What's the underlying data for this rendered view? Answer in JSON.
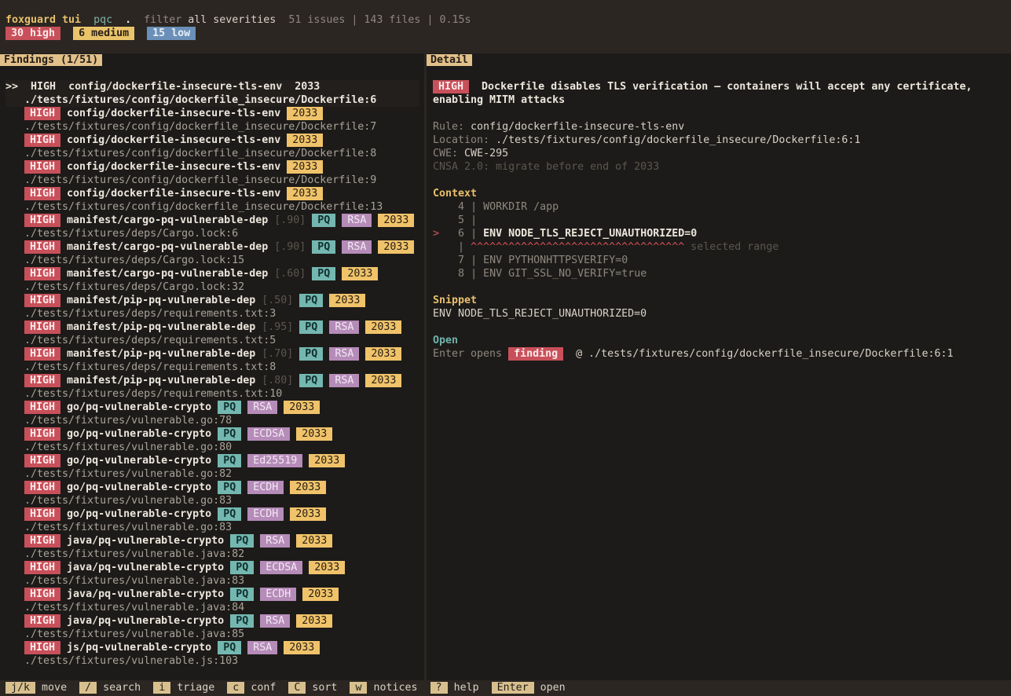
{
  "topbar": {
    "app": "foxguard tui",
    "mode": "pqc",
    "dir": ".",
    "filter_label": "filter",
    "filter_value": "all severities",
    "stats": "51 issues | 143 files | 0.15s",
    "counts": {
      "high": "30 high",
      "medium": "6 medium",
      "low": "15 low"
    }
  },
  "findings": {
    "title": "Findings (1/51)",
    "selected": {
      "marker": ">>",
      "severity": "HIGH",
      "rule": "config/dockerfile-insecure-tls-env",
      "deadline": "2033",
      "location": "./tests/fixtures/config/dockerfile_insecure/Dockerfile:6"
    },
    "items": [
      {
        "severity": "HIGH",
        "rule": "config/dockerfile-insecure-tls-env",
        "conf": "",
        "tags": [],
        "deadline": "2033",
        "location": "./tests/fixtures/config/dockerfile_insecure/Dockerfile:7"
      },
      {
        "severity": "HIGH",
        "rule": "config/dockerfile-insecure-tls-env",
        "conf": "",
        "tags": [],
        "deadline": "2033",
        "location": "./tests/fixtures/config/dockerfile_insecure/Dockerfile:8"
      },
      {
        "severity": "HIGH",
        "rule": "config/dockerfile-insecure-tls-env",
        "conf": "",
        "tags": [],
        "deadline": "2033",
        "location": "./tests/fixtures/config/dockerfile_insecure/Dockerfile:9"
      },
      {
        "severity": "HIGH",
        "rule": "config/dockerfile-insecure-tls-env",
        "conf": "",
        "tags": [],
        "deadline": "2033",
        "location": "./tests/fixtures/config/dockerfile_insecure/Dockerfile:13"
      },
      {
        "severity": "HIGH",
        "rule": "manifest/cargo-pq-vulnerable-dep",
        "conf": "[.90]",
        "tags": [
          "PQ",
          "RSA"
        ],
        "deadline": "2033",
        "location": "./tests/fixtures/deps/Cargo.lock:6"
      },
      {
        "severity": "HIGH",
        "rule": "manifest/cargo-pq-vulnerable-dep",
        "conf": "[.90]",
        "tags": [
          "PQ",
          "RSA"
        ],
        "deadline": "2033",
        "location": "./tests/fixtures/deps/Cargo.lock:15"
      },
      {
        "severity": "HIGH",
        "rule": "manifest/cargo-pq-vulnerable-dep",
        "conf": "[.60]",
        "tags": [
          "PQ"
        ],
        "deadline": "2033",
        "location": "./tests/fixtures/deps/Cargo.lock:32"
      },
      {
        "severity": "HIGH",
        "rule": "manifest/pip-pq-vulnerable-dep",
        "conf": "[.50]",
        "tags": [
          "PQ"
        ],
        "deadline": "2033",
        "location": "./tests/fixtures/deps/requirements.txt:3"
      },
      {
        "severity": "HIGH",
        "rule": "manifest/pip-pq-vulnerable-dep",
        "conf": "[.95]",
        "tags": [
          "PQ",
          "RSA"
        ],
        "deadline": "2033",
        "location": "./tests/fixtures/deps/requirements.txt:5"
      },
      {
        "severity": "HIGH",
        "rule": "manifest/pip-pq-vulnerable-dep",
        "conf": "[.70]",
        "tags": [
          "PQ",
          "RSA"
        ],
        "deadline": "2033",
        "location": "./tests/fixtures/deps/requirements.txt:8"
      },
      {
        "severity": "HIGH",
        "rule": "manifest/pip-pq-vulnerable-dep",
        "conf": "[.80]",
        "tags": [
          "PQ",
          "RSA"
        ],
        "deadline": "2033",
        "location": "./tests/fixtures/deps/requirements.txt:10"
      },
      {
        "severity": "HIGH",
        "rule": "go/pq-vulnerable-crypto",
        "conf": "",
        "tags": [
          "PQ",
          "RSA"
        ],
        "deadline": "2033",
        "location": "./tests/fixtures/vulnerable.go:78"
      },
      {
        "severity": "HIGH",
        "rule": "go/pq-vulnerable-crypto",
        "conf": "",
        "tags": [
          "PQ",
          "ECDSA"
        ],
        "deadline": "2033",
        "location": "./tests/fixtures/vulnerable.go:80"
      },
      {
        "severity": "HIGH",
        "rule": "go/pq-vulnerable-crypto",
        "conf": "",
        "tags": [
          "PQ",
          "Ed25519"
        ],
        "deadline": "2033",
        "location": "./tests/fixtures/vulnerable.go:82"
      },
      {
        "severity": "HIGH",
        "rule": "go/pq-vulnerable-crypto",
        "conf": "",
        "tags": [
          "PQ",
          "ECDH"
        ],
        "deadline": "2033",
        "location": "./tests/fixtures/vulnerable.go:83"
      },
      {
        "severity": "HIGH",
        "rule": "go/pq-vulnerable-crypto",
        "conf": "",
        "tags": [
          "PQ",
          "ECDH"
        ],
        "deadline": "2033",
        "location": "./tests/fixtures/vulnerable.go:83"
      },
      {
        "severity": "HIGH",
        "rule": "java/pq-vulnerable-crypto",
        "conf": "",
        "tags": [
          "PQ",
          "RSA"
        ],
        "deadline": "2033",
        "location": "./tests/fixtures/vulnerable.java:82"
      },
      {
        "severity": "HIGH",
        "rule": "java/pq-vulnerable-crypto",
        "conf": "",
        "tags": [
          "PQ",
          "ECDSA"
        ],
        "deadline": "2033",
        "location": "./tests/fixtures/vulnerable.java:83"
      },
      {
        "severity": "HIGH",
        "rule": "java/pq-vulnerable-crypto",
        "conf": "",
        "tags": [
          "PQ",
          "ECDH"
        ],
        "deadline": "2033",
        "location": "./tests/fixtures/vulnerable.java:84"
      },
      {
        "severity": "HIGH",
        "rule": "java/pq-vulnerable-crypto",
        "conf": "",
        "tags": [
          "PQ",
          "RSA"
        ],
        "deadline": "2033",
        "location": "./tests/fixtures/vulnerable.java:85"
      },
      {
        "severity": "HIGH",
        "rule": "js/pq-vulnerable-crypto",
        "conf": "",
        "tags": [
          "PQ",
          "RSA"
        ],
        "deadline": "2033",
        "location": "./tests/fixtures/vulnerable.js:103"
      }
    ]
  },
  "detail": {
    "title": "Detail",
    "severity": "HIGH",
    "message_line1": "Dockerfile disables TLS verification — containers will accept any certificate,",
    "message_line2": "enabling MITM attacks",
    "rule_label": "Rule:",
    "rule_value": "config/dockerfile-insecure-tls-env",
    "location_label": "Location:",
    "location_value": "./tests/fixtures/config/dockerfile_insecure/Dockerfile:6:1",
    "cwe_label": "CWE:",
    "cwe_value": "CWE-295",
    "cnsa": "CNSA 2.0: migrate before end of 2033",
    "context_title": "Context",
    "context": [
      {
        "marker": "",
        "num": "4",
        "code": "WORKDIR /app",
        "current": false
      },
      {
        "marker": "",
        "num": "5",
        "code": "",
        "current": false
      },
      {
        "marker": ">",
        "num": "6",
        "code": "ENV NODE_TLS_REJECT_UNAUTHORIZED=0",
        "current": true
      },
      {
        "marker": "",
        "num": "7",
        "code": "ENV PYTHONHTTPSVERIFY=0",
        "current": false
      },
      {
        "marker": "",
        "num": "8",
        "code": "ENV GIT_SSL_NO_VERIFY=true",
        "current": false
      }
    ],
    "carets": "^^^^^^^^^^^^^^^^^^^^^^^^^^^^^^^^^^",
    "selected_range": "selected range",
    "snippet_title": "Snippet",
    "snippet": "ENV NODE_TLS_REJECT_UNAUTHORIZED=0",
    "open_title": "Open",
    "open_prefix": "Enter opens",
    "open_badge": "finding",
    "open_at": "@ ./tests/fixtures/config/dockerfile_insecure/Dockerfile:6:1"
  },
  "footer": {
    "keys": [
      {
        "key": "j/k",
        "label": "move"
      },
      {
        "key": "/",
        "label": "search"
      },
      {
        "key": "i",
        "label": "triage"
      },
      {
        "key": "c",
        "label": "conf"
      },
      {
        "key": "C",
        "label": "sort"
      },
      {
        "key": "w",
        "label": "notices"
      },
      {
        "key": "?",
        "label": "help"
      },
      {
        "key": "Enter",
        "label": "open"
      }
    ]
  },
  "colors": {
    "background": "#1d1b19",
    "bar": "#2b2622",
    "high": "#c8505a",
    "medium": "#e9c46a",
    "low": "#6a8fb8",
    "pq": "#74b7b0",
    "algorithm": "#b58bb8",
    "accent": "#e2c08a"
  }
}
